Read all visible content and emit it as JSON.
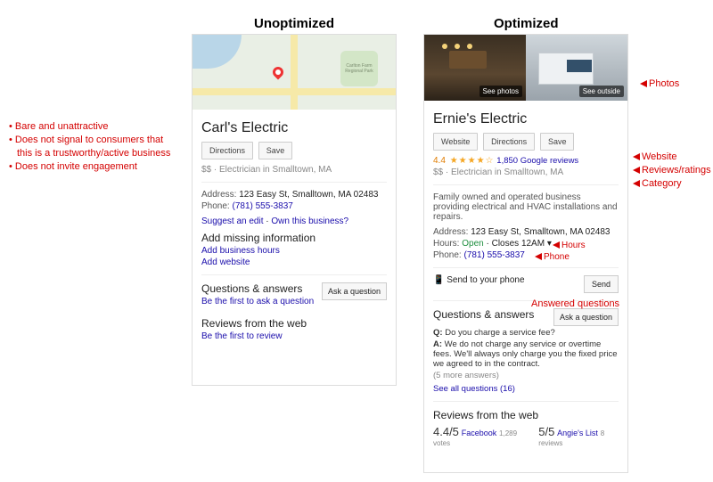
{
  "headings": {
    "unoptimized": "Unoptimized",
    "optimized": "Optimized"
  },
  "left_notes": {
    "l1": "Bare and unattractive",
    "l2a": "Does not signal to consumers that",
    "l2b": "this is a trustworthy/active business",
    "l3": "Does not invite engagement"
  },
  "annotations": {
    "photos": "Photos",
    "website": "Website",
    "reviews": "Reviews/ratings",
    "category": "Category",
    "hours": "Hours",
    "phone": "Phone",
    "answered": "Answered questions"
  },
  "unopt": {
    "map_park": "Carlton Farm Regional Park",
    "name": "Carl's Electric",
    "btn_directions": "Directions",
    "btn_save": "Save",
    "price": "$$",
    "sep": " · ",
    "category": "Electrician in Smalltown, MA",
    "address_label": "Address: ",
    "address": "123 Easy St, Smalltown, MA 02483",
    "phone_label": "Phone: ",
    "phone": "(781) 555-3837",
    "suggest": "Suggest an edit",
    "own": "Own this business?",
    "add_info": "Add missing information",
    "add_hours": "Add business hours",
    "add_website": "Add website",
    "qa_heading": "Questions & answers",
    "qa_first": "Be the first to ask a question",
    "ask": "Ask a question",
    "rev_heading": "Reviews from the web",
    "rev_first": "Be the first to review"
  },
  "opt": {
    "tag_photos": "See photos",
    "tag_outside": "See outside",
    "name": "Ernie's Electric",
    "btn_website": "Website",
    "btn_directions": "Directions",
    "btn_save": "Save",
    "rating": "4.4",
    "stars": "★★★★☆",
    "reviews": "1,850 Google reviews",
    "price": "$$",
    "sep": " · ",
    "category": "Electrician in Smalltown, MA",
    "desc": "Family owned and operated business providing electrical and HVAC installations and repairs.",
    "address_label": "Address: ",
    "address": "123 Easy St, Smalltown, MA 02483",
    "hours_label": "Hours: ",
    "hours_open": "Open",
    "hours_close": " · Closes 12AM ▾",
    "phone_label": "Phone: ",
    "phone": "(781) 555-3837",
    "send_icon": "📱",
    "send_label": "Send to your phone",
    "send_btn": "Send",
    "qa_heading": "Questions & answers",
    "ask": "Ask a question",
    "q_label": "Q: ",
    "q_text": "Do you charge a service fee?",
    "a_label": "A: ",
    "a_text": "We do not charge any service or overtime fees. We'll always only charge you the fixed price we agreed to in the contract.",
    "more_answers": "(5 more answers)",
    "see_all": "See all questions (16)",
    "rev_heading": "Reviews from the web",
    "rev1_score": "4.4/5",
    "rev1_src": "Facebook",
    "rev1_cnt": "1,289 votes",
    "rev2_score": "5/5",
    "rev2_src": "Angie's List",
    "rev2_cnt": "8 reviews"
  }
}
